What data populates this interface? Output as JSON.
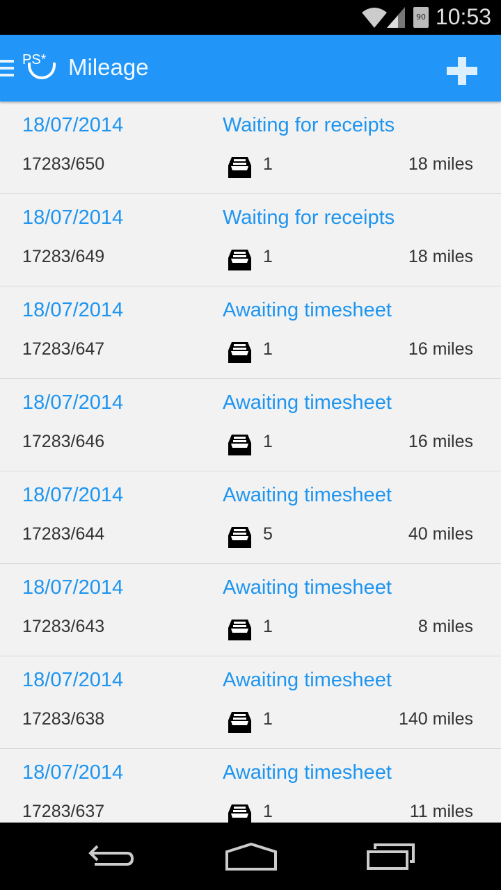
{
  "status_bar": {
    "time": "10:53",
    "battery": "90"
  },
  "app_bar": {
    "logo": "PS*",
    "title": "Mileage",
    "add_icon": "plus-icon",
    "menu_icon": "hamburger-icon"
  },
  "colors": {
    "accent": "#2196f8",
    "link": "#1e95f0"
  },
  "entries": [
    {
      "date": "18/07/2014",
      "status": "Waiting for receipts",
      "ref": "17283/650",
      "receipts": "1",
      "distance": "18 miles"
    },
    {
      "date": "18/07/2014",
      "status": "Waiting for receipts",
      "ref": "17283/649",
      "receipts": "1",
      "distance": "18 miles"
    },
    {
      "date": "18/07/2014",
      "status": "Awaiting timesheet",
      "ref": "17283/647",
      "receipts": "1",
      "distance": "16 miles"
    },
    {
      "date": "18/07/2014",
      "status": "Awaiting timesheet",
      "ref": "17283/646",
      "receipts": "1",
      "distance": "16 miles"
    },
    {
      "date": "18/07/2014",
      "status": "Awaiting timesheet",
      "ref": "17283/644",
      "receipts": "5",
      "distance": "40 miles"
    },
    {
      "date": "18/07/2014",
      "status": "Awaiting timesheet",
      "ref": "17283/643",
      "receipts": "1",
      "distance": "8 miles"
    },
    {
      "date": "18/07/2014",
      "status": "Awaiting timesheet",
      "ref": "17283/638",
      "receipts": "1",
      "distance": "140 miles"
    },
    {
      "date": "18/07/2014",
      "status": "Awaiting timesheet",
      "ref": "17283/637",
      "receipts": "1",
      "distance": "11 miles"
    }
  ]
}
